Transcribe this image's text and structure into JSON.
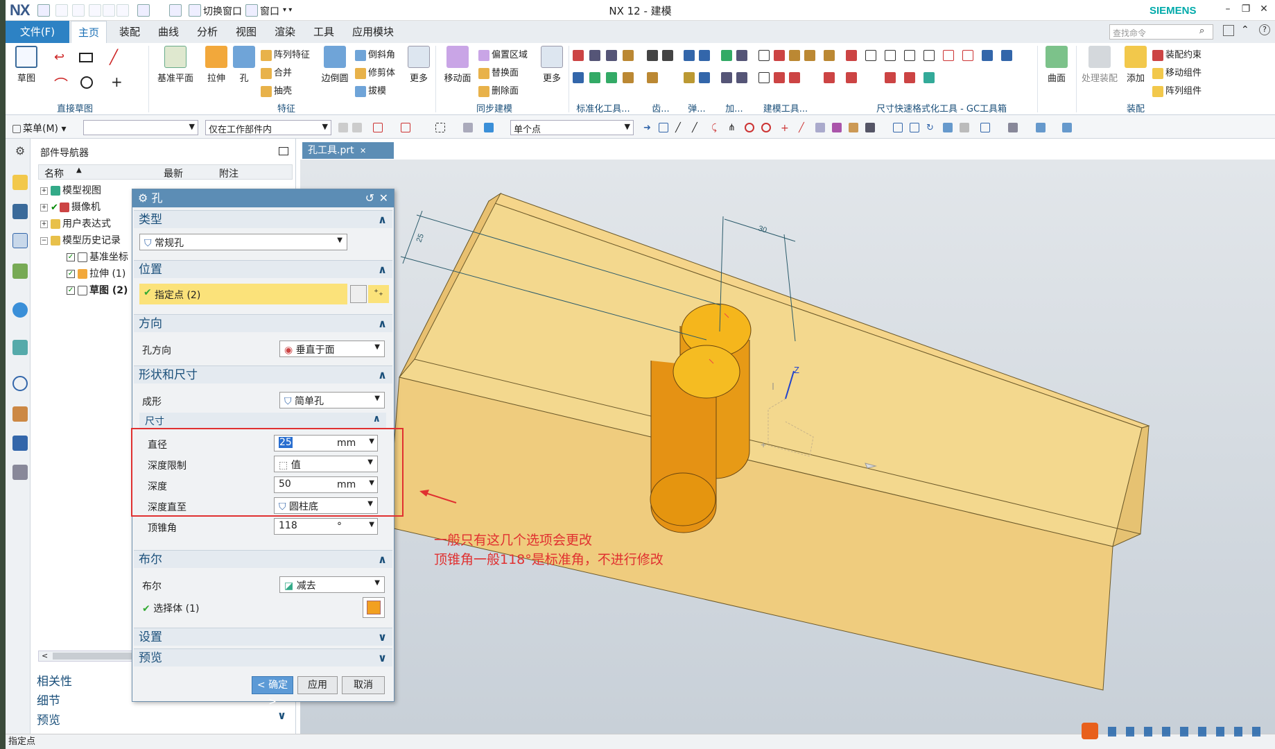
{
  "app": {
    "logo": "NX",
    "window_title": "NX 12 - 建模",
    "brand": "SIEMENS",
    "quick_access": {
      "switch_window": "切换窗口",
      "window": "窗口"
    },
    "search_placeholder": "查找命令"
  },
  "menu_tabs": [
    "文件(F)",
    "主页",
    "装配",
    "曲线",
    "分析",
    "视图",
    "渲染",
    "工具",
    "应用模块"
  ],
  "active_tab": "主页",
  "ribbon": {
    "groups": {
      "direct_sketch": "直接草图",
      "feature": "特征",
      "sync_modeling": "同步建模",
      "standard_tools": "标准化工具...",
      "gear": "齿...",
      "spring": "弹...",
      "machining": "加...",
      "modeling_tools": "建模工具...",
      "dimension_quick_format": "尺寸快速格式化工具 - GC工具箱",
      "assembly": "装配"
    },
    "sketch": "草图",
    "datum_plane": "基准平面",
    "extrude": "拉伸",
    "hole": "孔",
    "pattern_feature": "阵列特征",
    "unite": "合并",
    "shell": "抽壳",
    "edge_blend": "边倒圆",
    "chamfer": "倒斜角",
    "trim_body": "修剪体",
    "draft": "拔模",
    "more1": "更多",
    "move_face": "移动面",
    "offset_region": "偏置区域",
    "replace_face": "替换面",
    "delete_face": "删除面",
    "more2": "更多",
    "surface": "曲面",
    "process_assembly": "处理装配",
    "add": "添加",
    "assembly_constraint": "装配约束",
    "move_component": "移动组件",
    "pattern_component": "阵列组件"
  },
  "selection_bar": {
    "menu": "菜单(M)",
    "filter": "",
    "scope": "仅在工作部件内",
    "snap": "单个点"
  },
  "navigator": {
    "title": "部件导航器",
    "columns": [
      "名称",
      "最新",
      "附注"
    ],
    "tree": [
      {
        "label": "模型视图",
        "level": 0
      },
      {
        "label": "摄像机",
        "level": 0
      },
      {
        "label": "用户表达式",
        "level": 0
      },
      {
        "label": "模型历史记录",
        "level": 0
      },
      {
        "label": "基准坐标",
        "level": 1
      },
      {
        "label": "拉伸 (1)",
        "level": 1
      },
      {
        "label": "草图 (2)",
        "level": 1
      }
    ],
    "sections": [
      "相关性",
      "细节",
      "预览"
    ]
  },
  "dialog": {
    "title": "孔",
    "type_section": "类型",
    "type_value": "常规孔",
    "position_section": "位置",
    "specify_point": "指定点 (2)",
    "direction_section": "方向",
    "hole_direction_label": "孔方向",
    "hole_direction_value": "垂直于面",
    "shape_section": "形状和尺寸",
    "form_label": "成形",
    "form_value": "简单孔",
    "dimension_sub": "尺寸",
    "diameter_label": "直径",
    "diameter_value": "25",
    "diameter_unit": "mm",
    "depth_limit_label": "深度限制",
    "depth_limit_value": "值",
    "depth_label": "深度",
    "depth_value": "50",
    "depth_unit": "mm",
    "depth_to_label": "深度直至",
    "depth_to_value": "圆柱底",
    "tip_angle_label": "顶锥角",
    "tip_angle_value": "118",
    "tip_angle_unit": "°",
    "boolean_section": "布尔",
    "boolean_label": "布尔",
    "boolean_value": "减去",
    "select_body": "选择体 (1)",
    "settings_section": "设置",
    "preview_section": "预览",
    "ok": "< 确定 >",
    "apply": "应用",
    "cancel": "取消"
  },
  "viewport": {
    "tab": "孔工具.prt",
    "dim_label_1": "30",
    "dim_label_2": "25",
    "axis_z": "Z"
  },
  "annotation": {
    "line1": "一般只有这几个选项会更改",
    "line2": "顶锥角一般118°是标准角，不进行修改"
  },
  "status": "指定点",
  "colors": {
    "accent": "#2d82c4",
    "highlight": "#fbe27a",
    "annotation": "#e03030"
  }
}
